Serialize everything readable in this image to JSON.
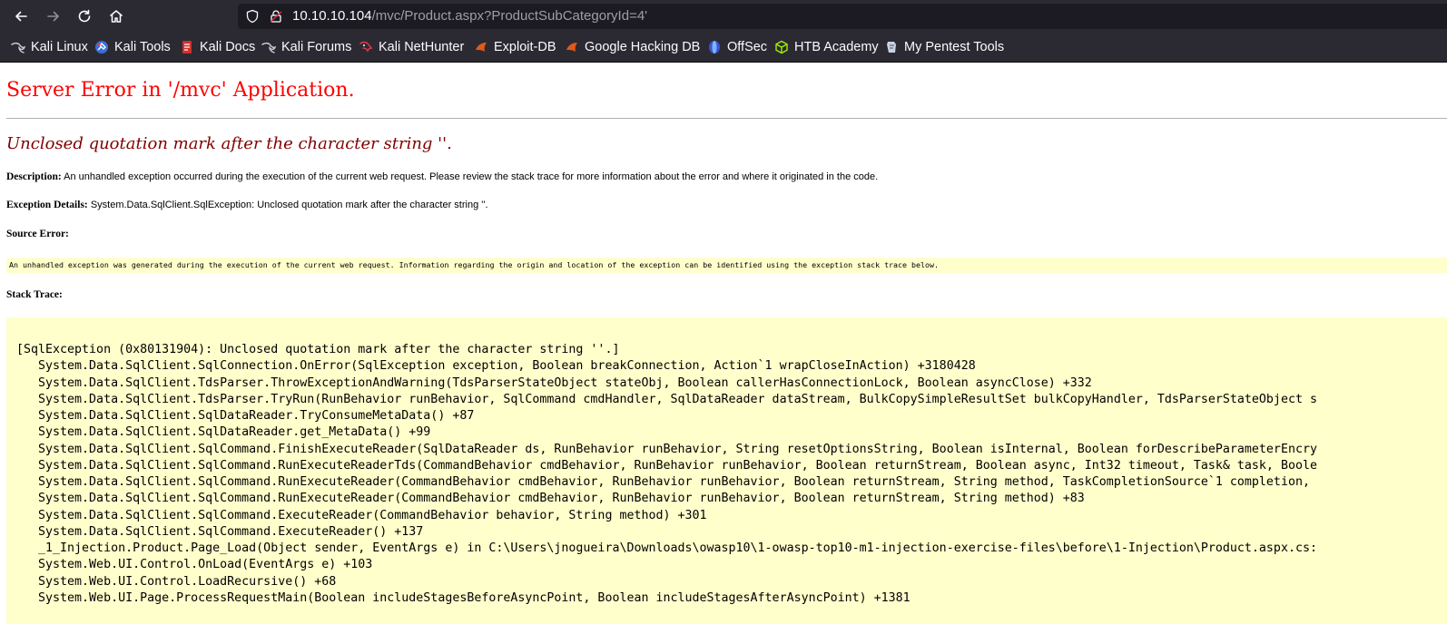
{
  "browser": {
    "url_host": "10.10.10.104",
    "url_path": "/mvc/Product.aspx?ProductSubCategoryId=4'",
    "bookmarks": [
      {
        "label": "Kali Linux",
        "icon": "kali-dragon-icon"
      },
      {
        "label": "Kali Tools",
        "icon": "kali-tools-icon"
      },
      {
        "label": "Kali Docs",
        "icon": "kali-docs-icon"
      },
      {
        "label": "Kali Forums",
        "icon": "kali-dragon-icon"
      },
      {
        "label": "Kali NetHunter",
        "icon": "nethunter-icon"
      },
      {
        "label": "Exploit-DB",
        "icon": "exploit-db-icon"
      },
      {
        "label": "Google Hacking DB",
        "icon": "ghdb-icon"
      },
      {
        "label": "OffSec",
        "icon": "offsec-icon"
      },
      {
        "label": "HTB Academy",
        "icon": "htb-cube-icon"
      },
      {
        "label": "My Pentest Tools",
        "icon": "pentest-tools-icon"
      }
    ]
  },
  "error": {
    "title": "Server Error in '/mvc' Application.",
    "message": "Unclosed quotation mark after the character string ''.",
    "description_label": "Description:",
    "description_text": " An unhandled exception occurred during the execution of the current web request. Please review the stack trace for more information about the error and where it originated in the code.",
    "exception_label": "Exception Details:",
    "exception_text": " System.Data.SqlClient.SqlException: Unclosed quotation mark after the character string ''.",
    "source_label": "Source Error:",
    "source_text": "An unhandled exception was generated during the execution of the current web request. Information regarding the origin and location of the exception can be identified using the exception stack trace below.",
    "stack_label": "Stack Trace:",
    "stack_lines": [
      "[SqlException (0x80131904): Unclosed quotation mark after the character string ''.]",
      "   System.Data.SqlClient.SqlConnection.OnError(SqlException exception, Boolean breakConnection, Action`1 wrapCloseInAction) +3180428",
      "   System.Data.SqlClient.TdsParser.ThrowExceptionAndWarning(TdsParserStateObject stateObj, Boolean callerHasConnectionLock, Boolean asyncClose) +332",
      "   System.Data.SqlClient.TdsParser.TryRun(RunBehavior runBehavior, SqlCommand cmdHandler, SqlDataReader dataStream, BulkCopySimpleResultSet bulkCopyHandler, TdsParserStateObject s",
      "   System.Data.SqlClient.SqlDataReader.TryConsumeMetaData() +87",
      "   System.Data.SqlClient.SqlDataReader.get_MetaData() +99",
      "   System.Data.SqlClient.SqlCommand.FinishExecuteReader(SqlDataReader ds, RunBehavior runBehavior, String resetOptionsString, Boolean isInternal, Boolean forDescribeParameterEncry",
      "   System.Data.SqlClient.SqlCommand.RunExecuteReaderTds(CommandBehavior cmdBehavior, RunBehavior runBehavior, Boolean returnStream, Boolean async, Int32 timeout, Task& task, Boole",
      "   System.Data.SqlClient.SqlCommand.RunExecuteReader(CommandBehavior cmdBehavior, RunBehavior runBehavior, Boolean returnStream, String method, TaskCompletionSource`1 completion,",
      "   System.Data.SqlClient.SqlCommand.RunExecuteReader(CommandBehavior cmdBehavior, RunBehavior runBehavior, Boolean returnStream, String method) +83",
      "   System.Data.SqlClient.SqlCommand.ExecuteReader(CommandBehavior behavior, String method) +301",
      "   System.Data.SqlClient.SqlCommand.ExecuteReader() +137",
      "   _1_Injection.Product.Page_Load(Object sender, EventArgs e) in C:\\Users\\jnogueira\\Downloads\\owasp10\\1-owasp-top10-m1-injection-exercise-files\\before\\1-Injection\\Product.aspx.cs:",
      "   System.Web.UI.Control.OnLoad(EventArgs e) +103",
      "   System.Web.UI.Control.LoadRecursive() +68",
      "   System.Web.UI.Page.ProcessRequestMain(Boolean includeStagesBeforeAsyncPoint, Boolean includeStagesAfterAsyncPoint) +1381"
    ]
  }
}
